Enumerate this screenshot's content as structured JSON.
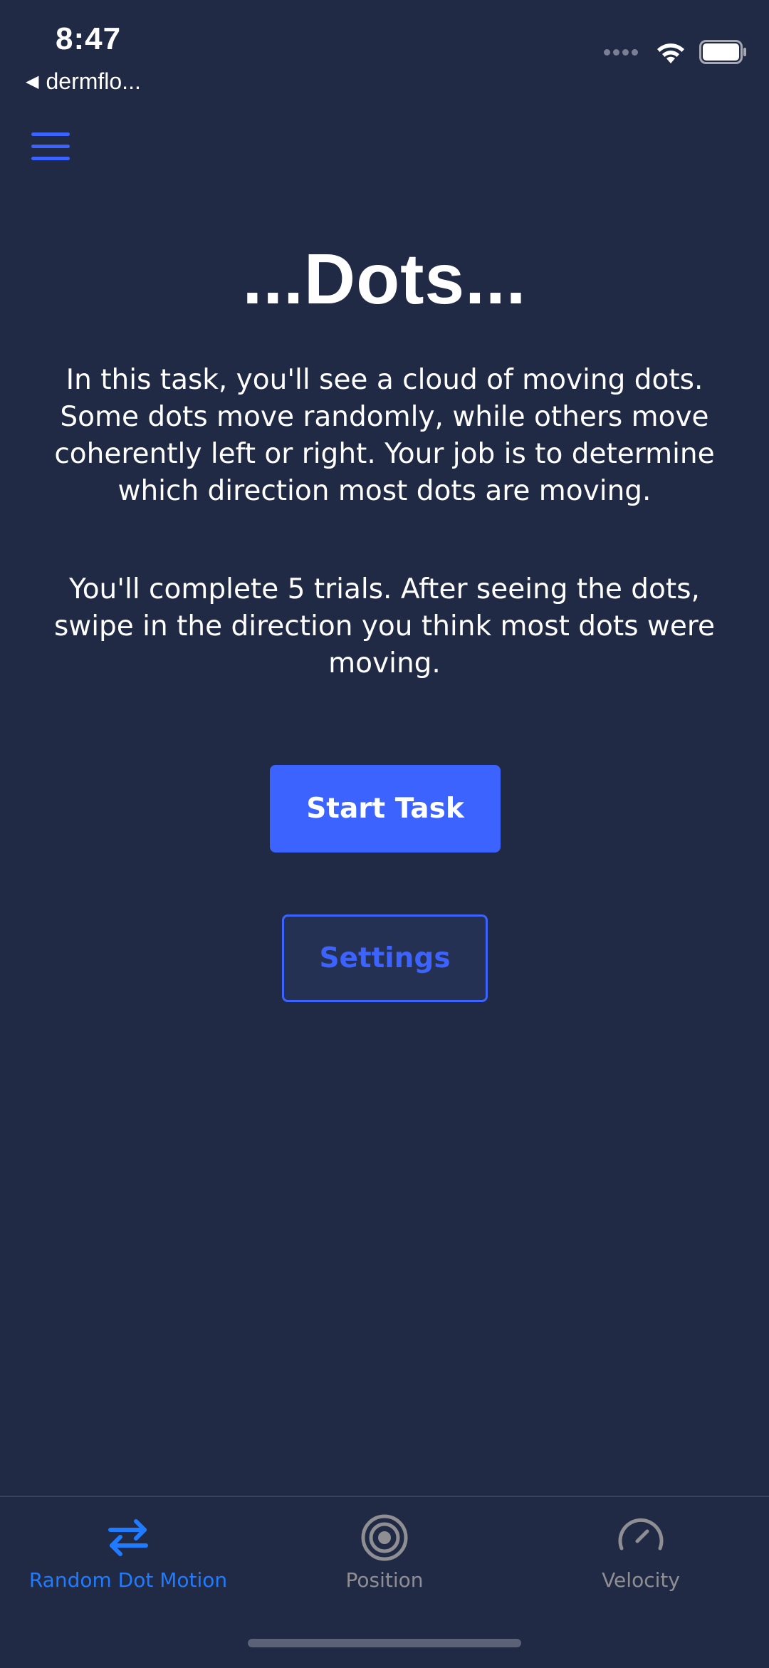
{
  "status_bar": {
    "time": "8:47",
    "back_app": "dermflo...",
    "icons": [
      "cellular-dots-icon",
      "wifi-icon",
      "battery-icon"
    ]
  },
  "header": {
    "menu_icon": "hamburger-menu-icon"
  },
  "main": {
    "title": "...Dots...",
    "paragraph_1": "In this task, you'll see a cloud of moving dots. Some dots move randomly, while others move coherently left or right. Your job is to determine which direction most dots are moving.",
    "paragraph_2": "You'll complete 5 trials. After seeing the dots, swipe in the direction you think most dots were moving.",
    "start_button": "Start Task",
    "settings_button": "Settings"
  },
  "tab_bar": {
    "tabs": [
      {
        "label": "Random Dot Motion",
        "icon": "arrows-left-right-icon",
        "active": true
      },
      {
        "label": "Position",
        "icon": "target-icon",
        "active": false
      },
      {
        "label": "Velocity",
        "icon": "speedometer-icon",
        "active": false
      }
    ]
  },
  "colors": {
    "background": "#212a45",
    "accent": "#3d63ff",
    "active_tab": "#1f7bff",
    "inactive_tab": "#8e8e93"
  }
}
